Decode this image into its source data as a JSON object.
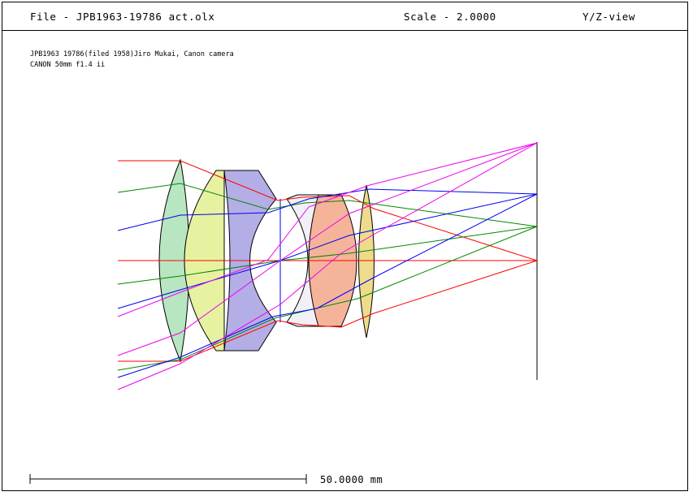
{
  "header": {
    "file_title": "File - JPB1963-19786 act.olx",
    "scale_label": "Scale - 2.0000",
    "view_label": "Y/Z-view"
  },
  "description": {
    "line1": "JPB1963 19786(filed 1958)Jiro Mukai, Canon camera",
    "line2": "CANON 50mm f1.4 ii"
  },
  "scale_bar": {
    "label": "50.0000 mm"
  },
  "colors": {
    "lens1": "#b8e6c0",
    "lens2": "#e6f2a0",
    "lens3": "#b4aee6",
    "lens4": "#f0f0f6",
    "lens5": "#f5b49a",
    "lens6": "#eedc8c",
    "ray_axial": "#ff0000",
    "ray_field1": "#008800",
    "ray_field2": "#0000ee",
    "ray_field3": "#ee00ee"
  }
}
